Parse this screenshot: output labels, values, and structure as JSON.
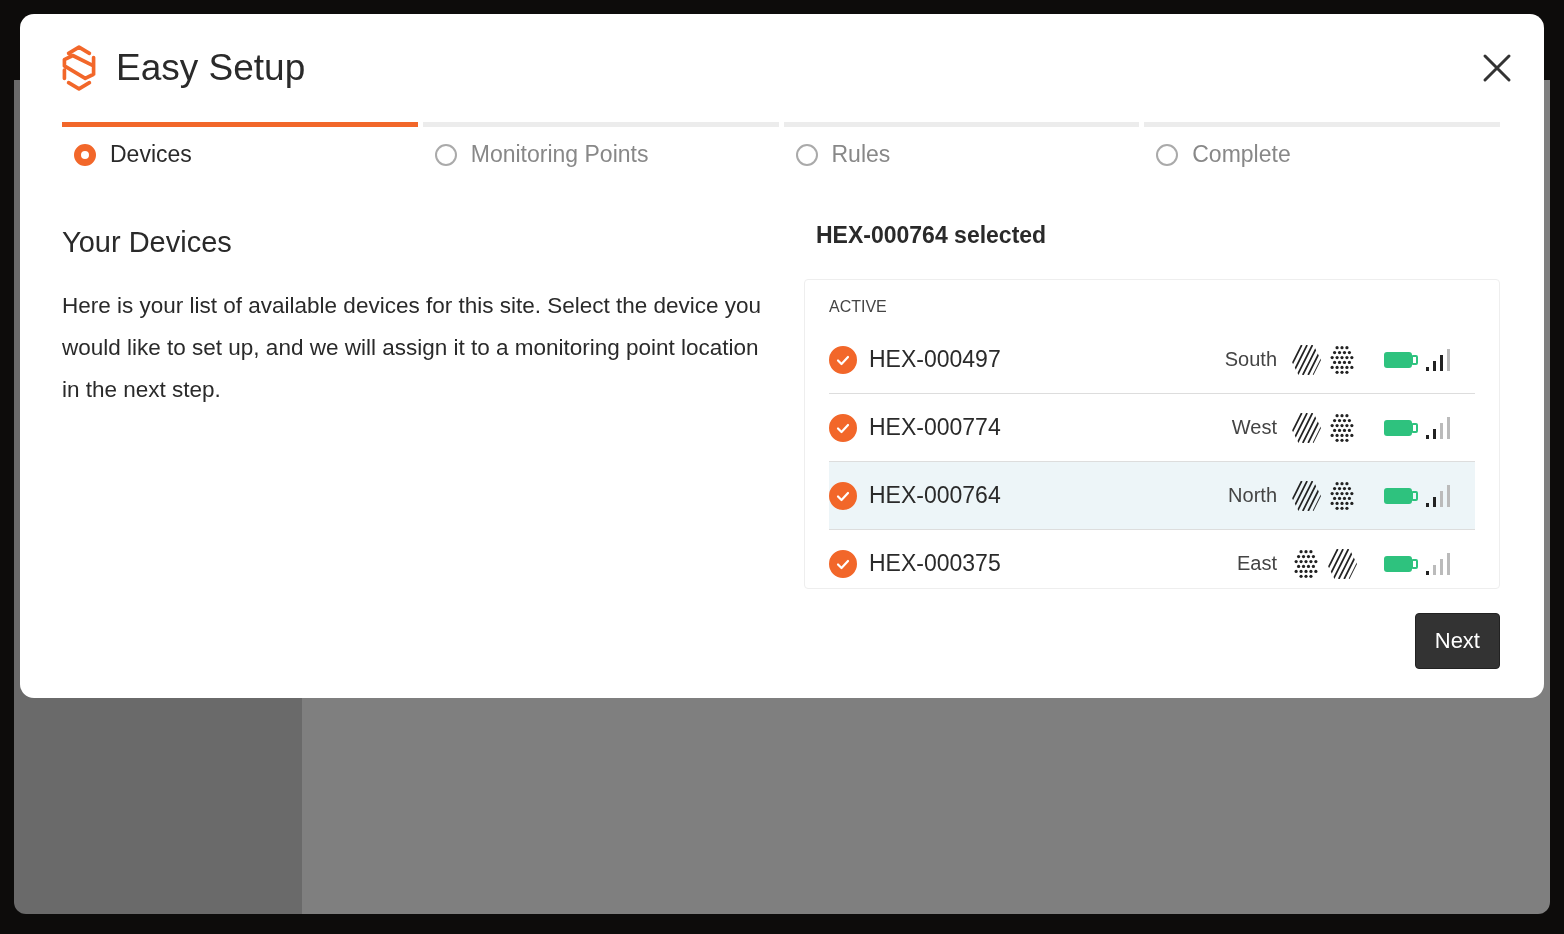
{
  "dialog": {
    "title": "Easy Setup"
  },
  "steps": [
    {
      "label": "Devices",
      "selected": true
    },
    {
      "label": "Monitoring Points",
      "selected": false
    },
    {
      "label": "Rules",
      "selected": false
    },
    {
      "label": "Complete",
      "selected": false
    }
  ],
  "intro": {
    "heading": "Your Devices",
    "text": "Here is your list of available devices for this site. Select the device you would like to set up, and we will assign it to a monitoring point location in the next step."
  },
  "selection_label": "HEX-000764 selected",
  "device_list": {
    "group": "ACTIVE",
    "rows": [
      {
        "name": "HEX-000497",
        "checked": true,
        "selected": false,
        "location": "South",
        "sensors": [
          {
            "kind": "striped"
          },
          {
            "kind": "dotted"
          }
        ],
        "signal_bars": [
          {
            "on": true
          },
          {
            "on": true
          },
          {
            "on": true
          },
          {
            "on": false
          }
        ]
      },
      {
        "name": "HEX-000774",
        "checked": true,
        "selected": false,
        "location": "West",
        "sensors": [
          {
            "kind": "striped"
          },
          {
            "kind": "dotted"
          }
        ],
        "signal_bars": [
          {
            "on": true
          },
          {
            "on": true
          },
          {
            "on": false
          },
          {
            "on": false
          }
        ]
      },
      {
        "name": "HEX-000764",
        "checked": true,
        "selected": true,
        "location": "North",
        "sensors": [
          {
            "kind": "striped"
          },
          {
            "kind": "dotted"
          }
        ],
        "signal_bars": [
          {
            "on": true
          },
          {
            "on": true
          },
          {
            "on": false
          },
          {
            "on": false
          }
        ]
      },
      {
        "name": "HEX-000375",
        "checked": true,
        "selected": false,
        "location": "East",
        "sensors": [
          {
            "kind": "dotted"
          },
          {
            "kind": "striped"
          }
        ],
        "signal_bars": [
          {
            "on": true
          },
          {
            "on": false
          },
          {
            "on": false
          },
          {
            "on": false
          }
        ]
      }
    ]
  },
  "buttons": {
    "next": "Next"
  }
}
